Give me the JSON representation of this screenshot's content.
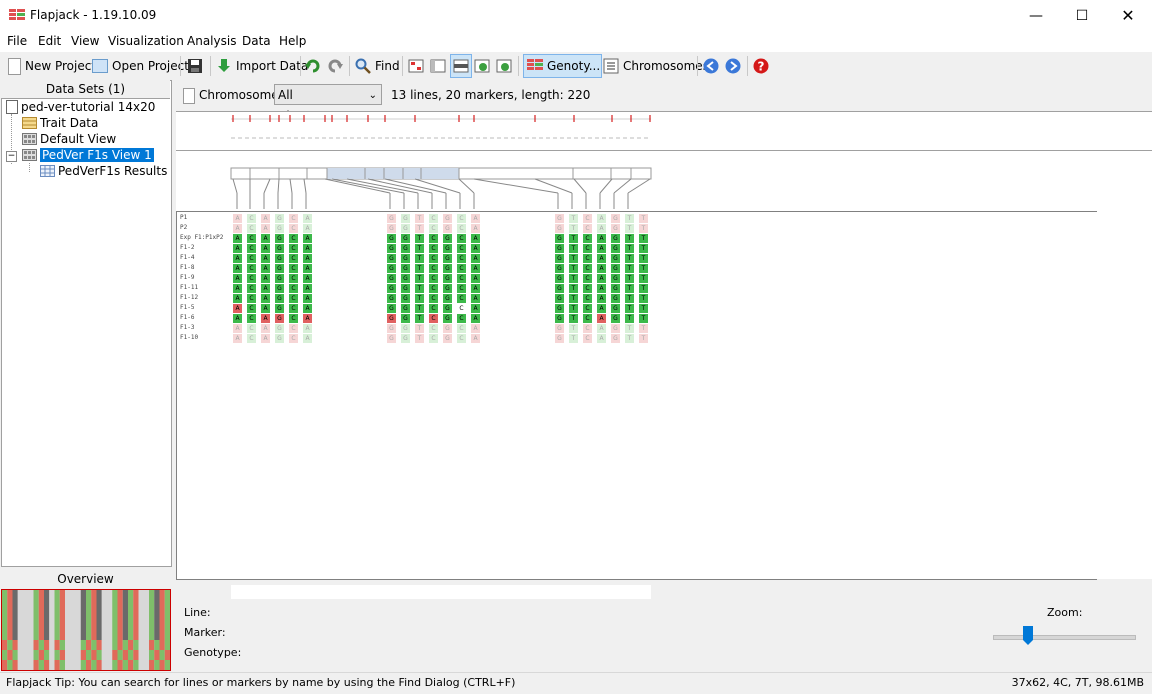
{
  "window": {
    "title": "Flapjack - 1.19.10.09"
  },
  "menu": [
    "File",
    "Edit",
    "View",
    "Visualization",
    "Analysis",
    "Data",
    "Help"
  ],
  "toolbar": {
    "new_project": "New Project",
    "open_project": "Open Project",
    "import_data": "Import Data",
    "find": "Find",
    "genotypes": "Genoty...",
    "chromosomes": "Chromosomes"
  },
  "sidebar": {
    "header": "Data Sets (1)",
    "items": [
      {
        "label": "ped-ver-tutorial  14x20"
      },
      {
        "label": "Trait Data"
      },
      {
        "label": "Default View"
      },
      {
        "label": "PedVer F1s View 1"
      },
      {
        "label": "PedVerF1s Results"
      }
    ],
    "overview_label": "Overview"
  },
  "chromosome_bar": {
    "label": "Chromosome:",
    "selected": "All Chromosomes",
    "info": "13 lines, 20 markers, length: 220"
  },
  "lines": [
    "P1",
    "P2",
    "Exp F1:P1xP2",
    "F1-2",
    "F1-4",
    "F1-8",
    "F1-9",
    "F1-11",
    "F1-12",
    "F1-5",
    "F1-6",
    "F1-3",
    "F1-10"
  ],
  "footer": {
    "line_label": "Line:",
    "marker_label": "Marker:",
    "genotype_label": "Genotype:",
    "zoom_label": "Zoom:"
  },
  "status": {
    "tip": "Flapjack Tip:  You can search for lines or markers by name by using the Find Dialog (CTRL+F)",
    "memory": "37x62, 4C, 7T, 98.61MB"
  },
  "colors": {
    "selected": "#0078d7",
    "green": "#3cb94a",
    "red": "#e06060",
    "faint_green": "#d8f0d8",
    "faint_red": "#f6d6d6"
  }
}
